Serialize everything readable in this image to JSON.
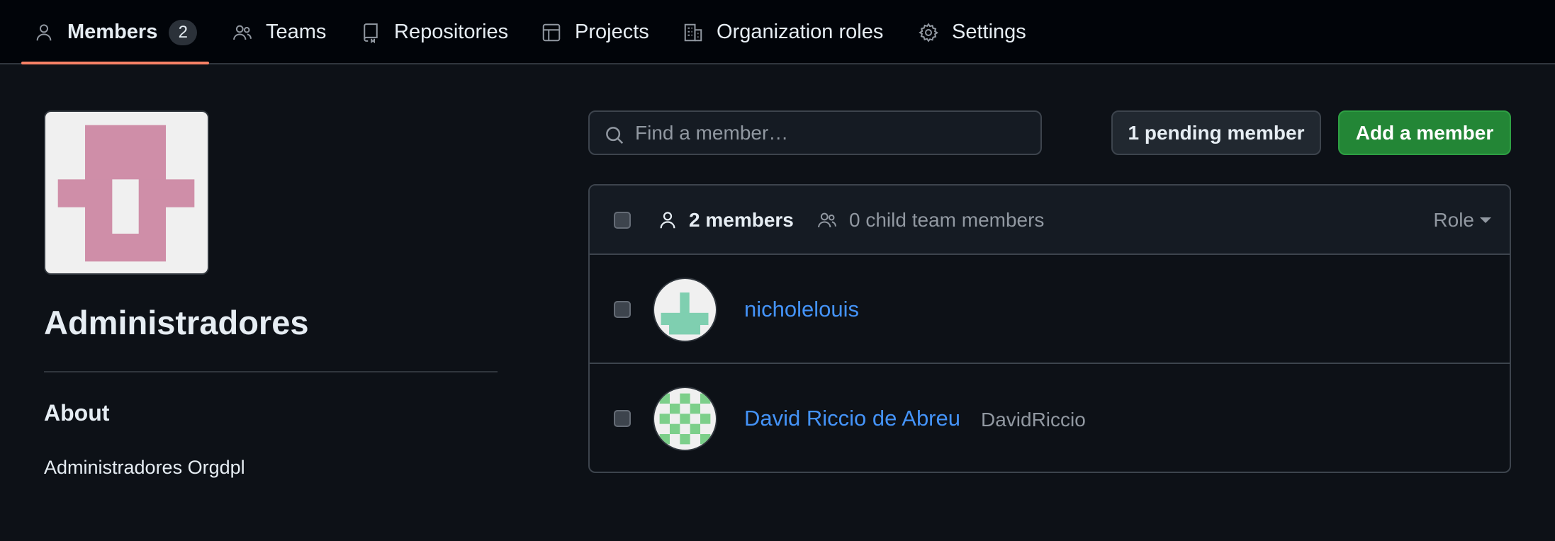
{
  "nav": {
    "tabs": [
      {
        "label": "Members",
        "icon": "person-icon",
        "counter": "2",
        "active": true
      },
      {
        "label": "Teams",
        "icon": "people-icon"
      },
      {
        "label": "Repositories",
        "icon": "repo-icon"
      },
      {
        "label": "Projects",
        "icon": "table-icon"
      },
      {
        "label": "Organization roles",
        "icon": "organization-icon"
      },
      {
        "label": "Settings",
        "icon": "gear-icon"
      }
    ],
    "active_color": "#f78166"
  },
  "team": {
    "name": "Administradores",
    "about_heading": "About",
    "description": "Administradores Orgdpl",
    "avatar_color": "#cf8ea8"
  },
  "search": {
    "placeholder": "Find a member…"
  },
  "buttons": {
    "pending": "1 pending member",
    "add": "Add a member"
  },
  "list": {
    "member_count": "2 members",
    "child_count": "0 child team members",
    "role_filter": "Role",
    "members": [
      {
        "name": "nicholelouis",
        "login": "",
        "avatar_color": "#7fcfb0"
      },
      {
        "name": "David Riccio de Abreu",
        "login": "DavidRiccio",
        "avatar_color": "#7ccf8a"
      }
    ]
  },
  "colors": {
    "link": "#4493f8",
    "primary_button": "#238636"
  }
}
